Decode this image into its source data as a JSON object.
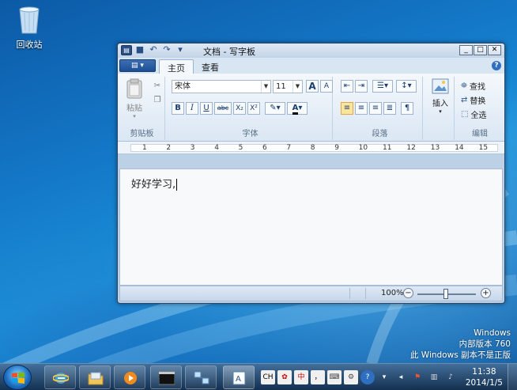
{
  "desktop": {
    "recycle_bin_label": "回收站"
  },
  "window": {
    "title": "文档 - 写字板",
    "tabs": [
      {
        "label": "主页",
        "active": true
      },
      {
        "label": "查看",
        "active": false
      }
    ],
    "clipboard": {
      "paste_label": "粘贴",
      "group_label": "剪贴板"
    },
    "font": {
      "font_name": "宋体",
      "font_size": "11",
      "bold": "B",
      "italic": "I",
      "underline": "U",
      "strike": "abc",
      "subscript": "X₂",
      "superscript": "X²",
      "color_a": "A",
      "grow": "A",
      "shrink": "A",
      "group_label": "字体"
    },
    "paragraph": {
      "group_label": "段落"
    },
    "insert": {
      "label": "插入"
    },
    "editing": {
      "find": "查找",
      "replace": "替换",
      "select_all": "全选",
      "group_label": "编辑"
    },
    "ruler_ticks": [
      "1",
      "2",
      "3",
      "4",
      "5",
      "6",
      "7",
      "8",
      "9",
      "10",
      "11",
      "12",
      "13",
      "14",
      "15"
    ],
    "document_text": "好好学习,",
    "zoom_label": "100%",
    "zoom_minus": "−",
    "zoom_plus": "+"
  },
  "watermark": {
    "line1": "Windows",
    "line2": "内部版本 760",
    "line3": "此 Windows 副本不是正版"
  },
  "taskbar": {
    "ime_ch": "CH",
    "ime_zhong": "中",
    "ime_comma": "，",
    "time": "11:38",
    "date": "2014/1/5"
  }
}
